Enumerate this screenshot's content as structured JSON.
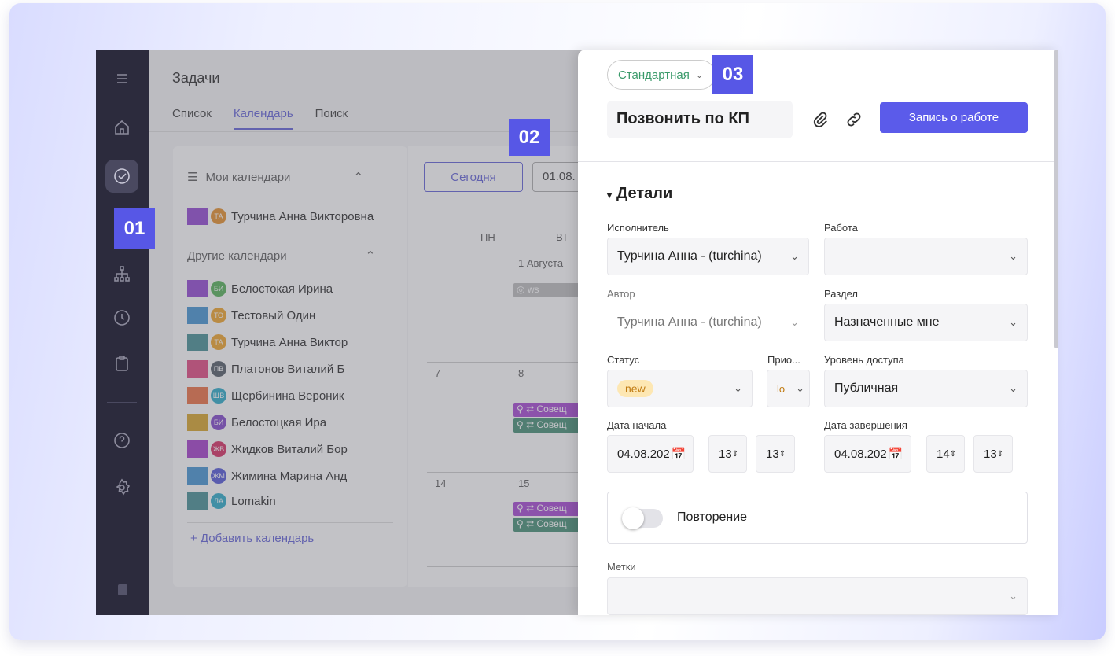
{
  "app": {
    "title": "Задачи"
  },
  "tabs": [
    {
      "label": "Список"
    },
    {
      "label": "Календарь"
    },
    {
      "label": "Поиск"
    }
  ],
  "sidebar": {
    "icons": [
      "menu-icon",
      "home-icon",
      "tasks-icon",
      "structure-icon",
      "clock-icon",
      "clipboard-icon",
      "help-icon",
      "settings-icon",
      "info-icon"
    ],
    "active": "tasks-icon"
  },
  "calendars": {
    "my_header": "Мои календари",
    "my": [
      {
        "name": "Турчина Анна Викторовна",
        "initials": "ТА",
        "color": "#8e3fd1",
        "avatar": "#e58a1f"
      }
    ],
    "other_header": "Другие календари",
    "other": [
      {
        "name": "Белостокая Ирина",
        "initials": "БИ",
        "color": "#8e3fd1",
        "avatar": "#4caf50"
      },
      {
        "name": "Тестовый Один",
        "initials": "ТО",
        "color": "#3b8fd1",
        "avatar": "#f0a020"
      },
      {
        "name": "Турчина Анна Виктор",
        "initials": "ТА",
        "color": "#3d8a8f",
        "avatar": "#f0a020"
      },
      {
        "name": "Платонов Виталий Б",
        "initials": "ПВ",
        "color": "#e0407a",
        "avatar": "#4a5560"
      },
      {
        "name": "Щербинина Вероник",
        "initials": "ЩВ",
        "color": "#ec6a3a",
        "avatar": "#21a7c7"
      },
      {
        "name": "Белостоцкая Ира",
        "initials": "БИ",
        "color": "#d6a020",
        "avatar": "#7a3fc9"
      },
      {
        "name": "Жидков Виталий Бор",
        "initials": "ЖВ",
        "color": "#a035c9",
        "avatar": "#d6245a"
      },
      {
        "name": "Жимина Марина Анд",
        "initials": "ЖМ",
        "color": "#3b8fd1",
        "avatar": "#4a50d6"
      },
      {
        "name": "Lomakin",
        "initials": "ЛА",
        "color": "#3d8a8f",
        "avatar": "#21a7c7"
      }
    ],
    "add_label": "+ Добавить календарь"
  },
  "calendar_view": {
    "today_label": "Сегодня",
    "date_value": "01.08.",
    "days": [
      "ПН",
      "ВТ"
    ],
    "cells": [
      "1 Августа",
      "7",
      "8",
      "14",
      "15"
    ],
    "events": [
      "ws",
      "Совещ",
      "Совещ",
      "Совещ",
      "Совещ"
    ]
  },
  "badges": {
    "b1": "01",
    "b2": "02",
    "b3": "03"
  },
  "task": {
    "type": "Стандартная",
    "title": "Позвонить по КП",
    "work_log_label": "Запись о работе",
    "details_title": "Детали",
    "assignee_label": "Исполнитель",
    "assignee_value": "Турчина Анна - (turchina)",
    "work_label": "Работа",
    "work_value": "",
    "author_label": "Автор",
    "author_value": "Турчина Анна - (turchina)",
    "section_label": "Раздел",
    "section_value": "Назначенные мне",
    "status_label": "Статус",
    "status_value": "new",
    "priority_label": "Прио...",
    "priority_value": "lo",
    "access_label": "Уровень доступа",
    "access_value": "Публичная",
    "start_label": "Дата начала",
    "start_date": "04.08.202",
    "start_hour": "13",
    "start_min": "13",
    "end_label": "Дата завершения",
    "end_date": "04.08.202",
    "end_hour": "14",
    "end_min": "13",
    "repeat_label": "Повторение",
    "tags_label": "Метки",
    "tags_value": ""
  }
}
